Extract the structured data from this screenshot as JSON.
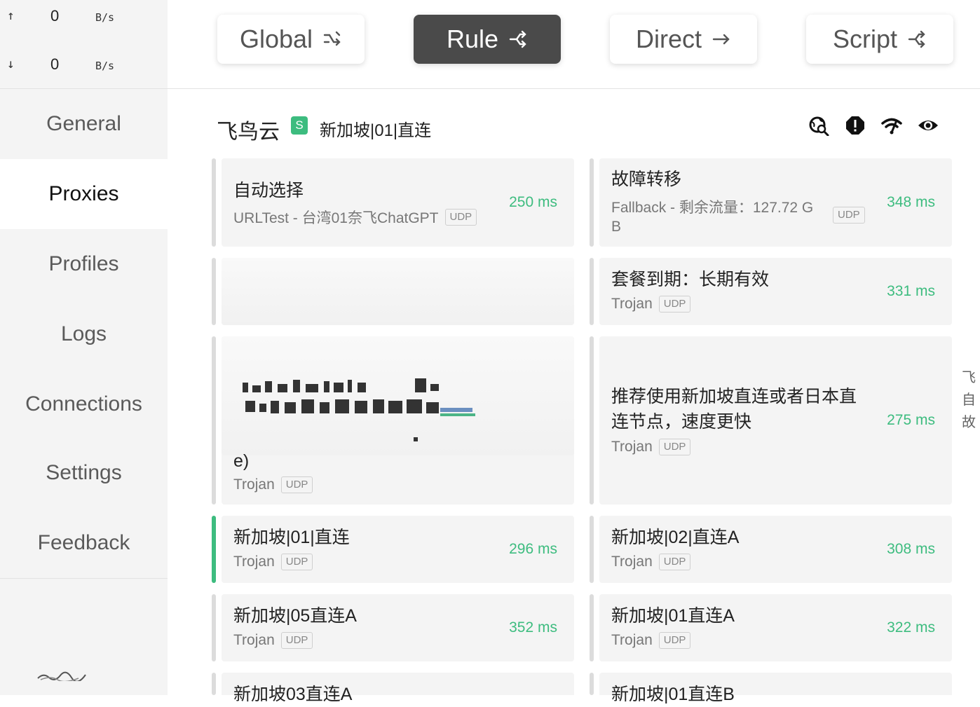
{
  "traffic": {
    "up": {
      "arrow": "↑",
      "value": "0",
      "unit": "B/s"
    },
    "down": {
      "arrow": "↓",
      "value": "0",
      "unit": "B/s"
    }
  },
  "nav": [
    "General",
    "Proxies",
    "Profiles",
    "Logs",
    "Connections",
    "Settings",
    "Feedback"
  ],
  "nav_active": "Proxies",
  "modes": [
    {
      "label": "Global",
      "icon": "shuffle-arrow-icon"
    },
    {
      "label": "Rule",
      "icon": "fork-arrow-icon"
    },
    {
      "label": "Direct",
      "icon": "right-arrow-icon"
    },
    {
      "label": "Script",
      "icon": "fork-arrow-icon"
    }
  ],
  "active_mode": "Rule",
  "group": {
    "title": "飞鸟云",
    "type_badge": "S",
    "current": "新加坡|01|直连",
    "tools": [
      "search-location-icon",
      "alert-icon",
      "wifi-speed-icon",
      "eye-icon"
    ]
  },
  "proxies": [
    {
      "name": "自动选择",
      "type": "URLTest - 台湾01奈飞ChatGPT",
      "udp": "UDP",
      "delay": "250 ms"
    },
    {
      "name": "故障转移",
      "type": "Fallback - 剩余流量：127.72 G",
      "type2": "B",
      "udp": "UDP",
      "delay": "348 ms"
    },
    {
      "name": "",
      "type": "",
      "udp": "",
      "delay": ""
    },
    {
      "name": "套餐到期：长期有效",
      "type": "Trojan",
      "udp": "UDP",
      "delay": "331 ms"
    },
    {
      "name": "e)",
      "type": "Trojan",
      "udp": "UDP",
      "delay": ""
    },
    {
      "name": "推荐使用新加坡直连或者日本直",
      "name2": "连节点，速度更快",
      "type": "Trojan",
      "udp": "UDP",
      "delay": "275 ms"
    },
    {
      "name": "新加坡|01|直连",
      "type": "Trojan",
      "udp": "UDP",
      "delay": "296 ms"
    },
    {
      "name": "新加坡|02|直连A",
      "type": "Trojan",
      "udp": "UDP",
      "delay": "308 ms"
    },
    {
      "name": "新加坡|05直连A",
      "type": "Trojan",
      "udp": "UDP",
      "delay": "352 ms"
    },
    {
      "name": "新加坡|01直连A",
      "type": "Trojan",
      "udp": "UDP",
      "delay": "322 ms"
    },
    {
      "name": "新加坡03直连A",
      "type": "",
      "udp": "",
      "delay": ""
    },
    {
      "name": "新加坡|01直连B",
      "type": "",
      "udp": "",
      "delay": ""
    }
  ],
  "edge_chars": [
    "飞",
    "自",
    "故"
  ],
  "colors": {
    "accent": "#3dbc7f",
    "active_mode_bg": "#4a4a4a",
    "sidebar_bg": "#f4f4f4",
    "card_bg": "#f4f4f4"
  }
}
